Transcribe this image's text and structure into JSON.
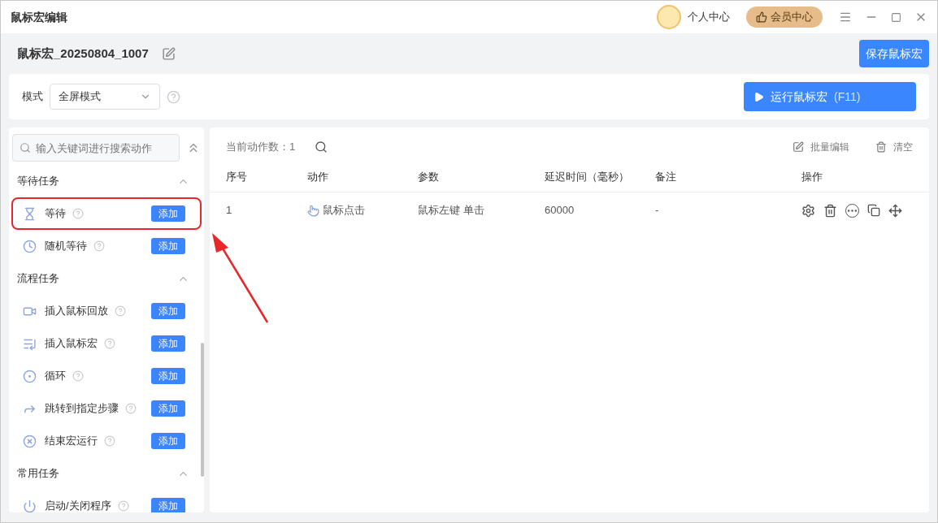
{
  "window": {
    "title": "鼠标宏编辑",
    "profile": "个人中心",
    "member": "会员中心"
  },
  "header": {
    "name": "鼠标宏_20250804_1007",
    "save": "保存鼠标宏"
  },
  "mode": {
    "label": "模式",
    "value": "全屏模式",
    "run": "运行鼠标宏",
    "run_key": "(F11)"
  },
  "sidebar": {
    "search": {
      "placeholder": "输入关键词进行搜索动作"
    },
    "groups": [
      {
        "title": "等待任务",
        "expanded": true,
        "items": [
          {
            "kind": "hourglass",
            "label": "等待",
            "add": "添加",
            "highlighted": true
          },
          {
            "kind": "clock",
            "label": "随机等待",
            "add": "添加",
            "highlighted": false
          }
        ]
      },
      {
        "title": "流程任务",
        "expanded": true,
        "items": [
          {
            "kind": "video",
            "label": "插入鼠标回放",
            "add": "添加",
            "highlighted": false
          },
          {
            "kind": "list",
            "label": "插入鼠标宏",
            "add": "添加",
            "highlighted": false
          },
          {
            "kind": "loop",
            "label": "循环",
            "add": "添加",
            "highlighted": false
          },
          {
            "kind": "jump",
            "label": "跳转到指定步骤",
            "add": "添加",
            "highlighted": false
          },
          {
            "kind": "stop",
            "label": "结束宏运行",
            "add": "添加",
            "highlighted": false
          }
        ]
      },
      {
        "title": "常用任务",
        "expanded": true,
        "items": [
          {
            "kind": "program",
            "label": "启动/关闭程序",
            "add": "添加",
            "highlighted": false
          }
        ]
      }
    ]
  },
  "table": {
    "count": "当前动作数：1",
    "batch_edit": "批量编辑",
    "clear": "清空",
    "columns": [
      "序号",
      "动作",
      "参数",
      "延迟时间（毫秒）",
      "备注",
      "操作"
    ],
    "rows": [
      {
        "index": "1",
        "action": "鼠标点击",
        "params": "鼠标左键 单击",
        "delay": "60000",
        "note": "-"
      }
    ]
  }
}
